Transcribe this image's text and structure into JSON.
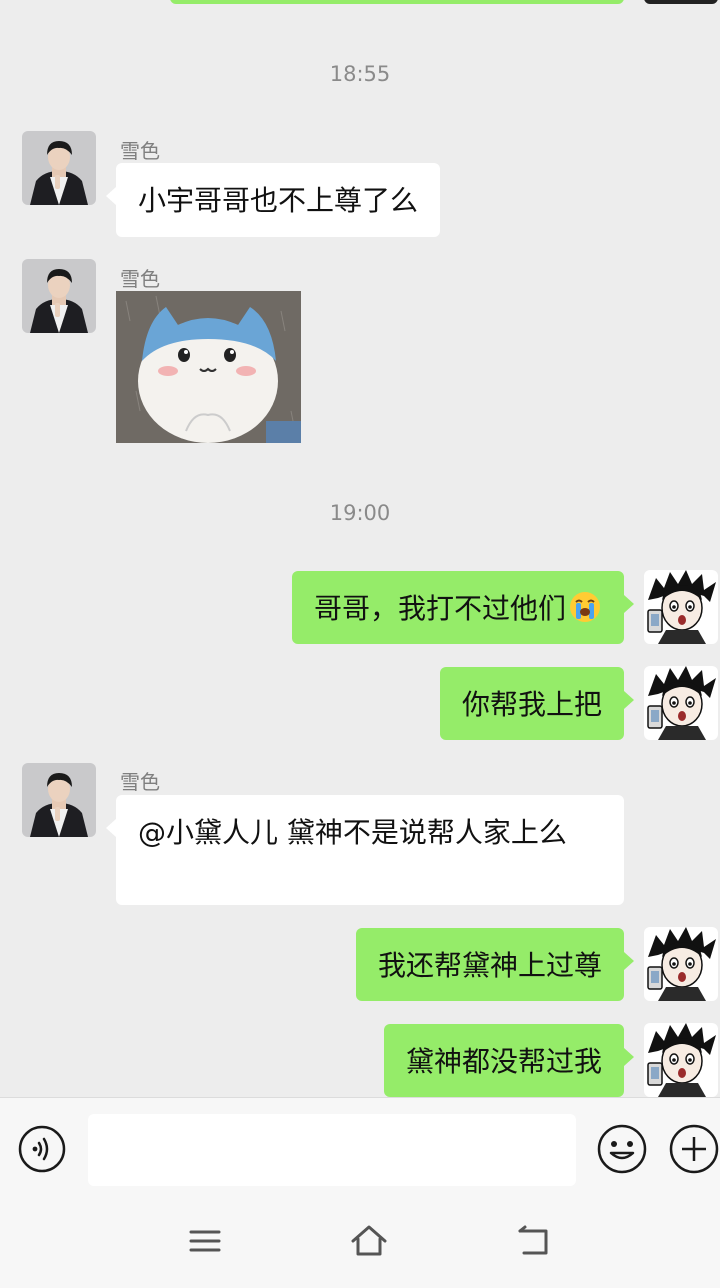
{
  "chat": {
    "timestamps": [
      "18:55",
      "19:00"
    ],
    "messages": [
      {
        "sender": "雪色",
        "text": "小宇哥哥也不上尊了么"
      },
      {
        "sender": "雪色",
        "type": "sticker"
      },
      {
        "text": "哥哥，我打不过他们",
        "emoji": "loudly-crying-face"
      },
      {
        "text": "你帮我上把"
      },
      {
        "sender": "雪色",
        "text": "@小黛人儿  黛神不是说帮人家上么"
      },
      {
        "text": "我还帮黛神上过尊"
      },
      {
        "text": "黛神都没帮过我"
      }
    ]
  },
  "input_bar": {
    "placeholder": "",
    "icons": [
      "voice-icon",
      "emoji-icon",
      "plus-icon"
    ]
  },
  "nav_bar": {
    "icons": [
      "menu-icon",
      "home-icon",
      "back-icon"
    ]
  },
  "colors": {
    "background": "#ededed",
    "outgoing_bubble": "#95ec69",
    "incoming_bubble": "#ffffff"
  }
}
